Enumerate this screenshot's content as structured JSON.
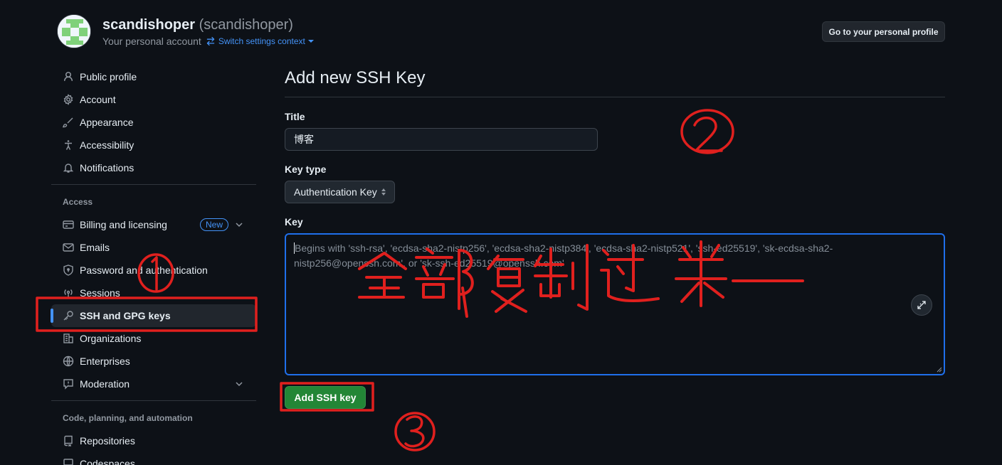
{
  "header": {
    "display_name": "scandishoper",
    "login": "(scandishoper)",
    "subtitle": "Your personal account",
    "switch_label": "Switch settings context",
    "profile_button": "Go to your personal profile"
  },
  "sidebar": {
    "items_top": [
      {
        "label": "Public profile",
        "icon": "person-icon"
      },
      {
        "label": "Account",
        "icon": "gear-icon"
      },
      {
        "label": "Appearance",
        "icon": "paintbrush-icon"
      },
      {
        "label": "Accessibility",
        "icon": "accessibility-icon"
      },
      {
        "label": "Notifications",
        "icon": "bell-icon"
      }
    ],
    "access_heading": "Access",
    "access_items": [
      {
        "label": "Billing and licensing",
        "icon": "credit-card-icon",
        "badge": "New"
      },
      {
        "label": "Emails",
        "icon": "mail-icon"
      },
      {
        "label": "Password and authentication",
        "icon": "shield-lock-icon"
      },
      {
        "label": "Sessions",
        "icon": "broadcast-icon"
      },
      {
        "label": "SSH and GPG keys",
        "icon": "key-icon",
        "active": true
      },
      {
        "label": "Organizations",
        "icon": "organization-icon"
      },
      {
        "label": "Enterprises",
        "icon": "globe-icon"
      },
      {
        "label": "Moderation",
        "icon": "report-icon"
      }
    ],
    "code_heading": "Code, planning, and automation",
    "code_items": [
      {
        "label": "Repositories",
        "icon": "repo-icon"
      },
      {
        "label": "Codespaces",
        "icon": "codespaces-icon"
      }
    ]
  },
  "main": {
    "title": "Add new SSH Key",
    "title_label": "Title",
    "title_value": "博客",
    "key_type_label": "Key type",
    "key_type_value": "Authentication Key",
    "key_label": "Key",
    "key_placeholder": "Begins with 'ssh-rsa', 'ecdsa-sha2-nistp256', 'ecdsa-sha2-nistp384', 'ecdsa-sha2-nistp521', 'ssh-ed25519', 'sk-ecdsa-sha2-nistp256@openssh.com', or 'sk-ssh-ed25519@openssh.com'",
    "submit_label": "Add SSH key"
  },
  "annotations": {
    "color": "#e0201e",
    "note_text": "全部复制过来",
    "marker_1": "①",
    "marker_2": "②",
    "marker_3": "③"
  }
}
